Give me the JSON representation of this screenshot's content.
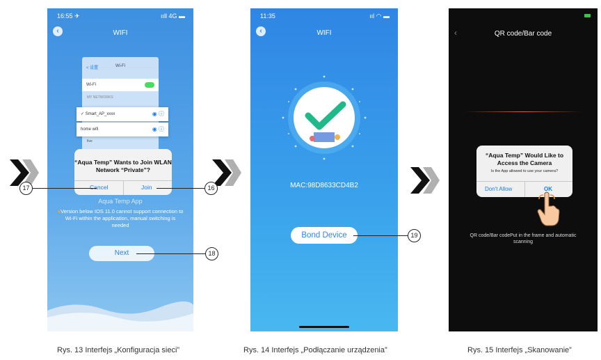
{
  "panel1": {
    "status_time": "16:55 ✈",
    "status_right": "ııll 4G ▬",
    "nav_title": "WIFI",
    "mini_header_left": "< 设置",
    "mini_header_title": "Wi-Fi",
    "wifi_label": "Wi-Fi",
    "my_networks": "MY NETWORKS",
    "network1": "Smart_AP_xxxx",
    "network2": "home wifi",
    "network3": "five",
    "network4": "xxxxxxxx TV",
    "dialog_text": "“Aqua Temp” Wants to Join WLAN Network “Private”?",
    "cancel_label": "Cancel",
    "join_label": "Join",
    "app_text": "Aqua Temp App",
    "note": "Version below IOS 11.0 cannot support connection to Wi-Fi within the application, manual switching is needed",
    "next_label": "Next",
    "caption": "Rys. 13 Interfejs „Konfiguracja sieci”"
  },
  "panel2": {
    "status_time": "11:35",
    "status_right": "ııl ◠ ▬",
    "nav_title": "WIFI",
    "mac_text": "MAC:98D8633CD4B2",
    "bond_label": "Bond Device",
    "caption": "Rys. 14 Interfejs „Podłączanie urządzenia”"
  },
  "panel3": {
    "nav_title": "QR code/Bar code",
    "dialog_title": "“Aqua Temp” Would Like to Access the Camera",
    "dialog_sub": "Is the App allowed to use your camera?",
    "dont_allow_label": "Don't Allow",
    "ok_label": "OK",
    "scan_hint": "QR code/Bar codePut in the frame and automatic scanning",
    "caption": "Rys. 15 Interfejs „Skanowanie”"
  },
  "callouts": {
    "c17": "17",
    "c16": "16",
    "c18": "18",
    "c19": "19"
  },
  "colors": {
    "ios_blue": "#1a7cf0",
    "check_green": "#1fb98a",
    "toggle_green": "#4cd964",
    "scan_line": "#d46a2a"
  }
}
